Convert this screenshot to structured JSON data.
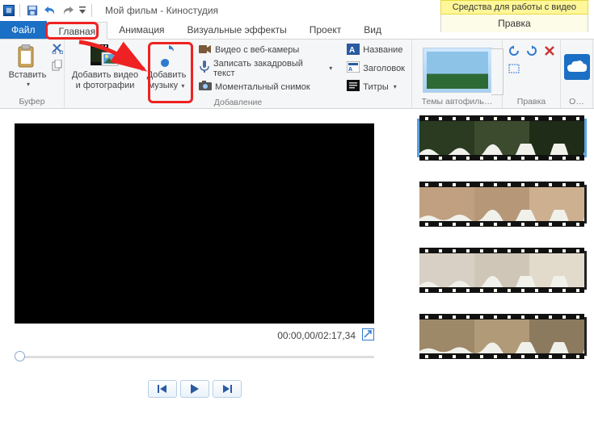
{
  "title": "Мой фильм - Киностудия",
  "contextual": {
    "label": "Средства для работы с видео",
    "tab": "Правка"
  },
  "tabs": {
    "file": "Файл",
    "home": "Главная",
    "anim": "Анимация",
    "fx": "Визуальные эффекты",
    "project": "Проект",
    "view": "Вид"
  },
  "groups": {
    "buffer": {
      "label": "Буфер",
      "paste": "Вставить"
    },
    "add": {
      "label": "Добавление",
      "addmedia_l1": "Добавить видео",
      "addmedia_l2": "и фотографии",
      "addmusic_l1": "Добавить",
      "addmusic_l2": "музыку",
      "webcam": "Видео с веб-камеры",
      "narration": "Записать закадровый текст",
      "snapshot": "Моментальный снимок",
      "title": "Название",
      "heading": "Заголовок",
      "credits": "Титры"
    },
    "themes": {
      "label": "Темы автофиль…"
    },
    "edit": {
      "label": "Правка"
    },
    "share": {
      "label": "О…"
    }
  },
  "player": {
    "time": "00:00,00/02:17,34"
  }
}
